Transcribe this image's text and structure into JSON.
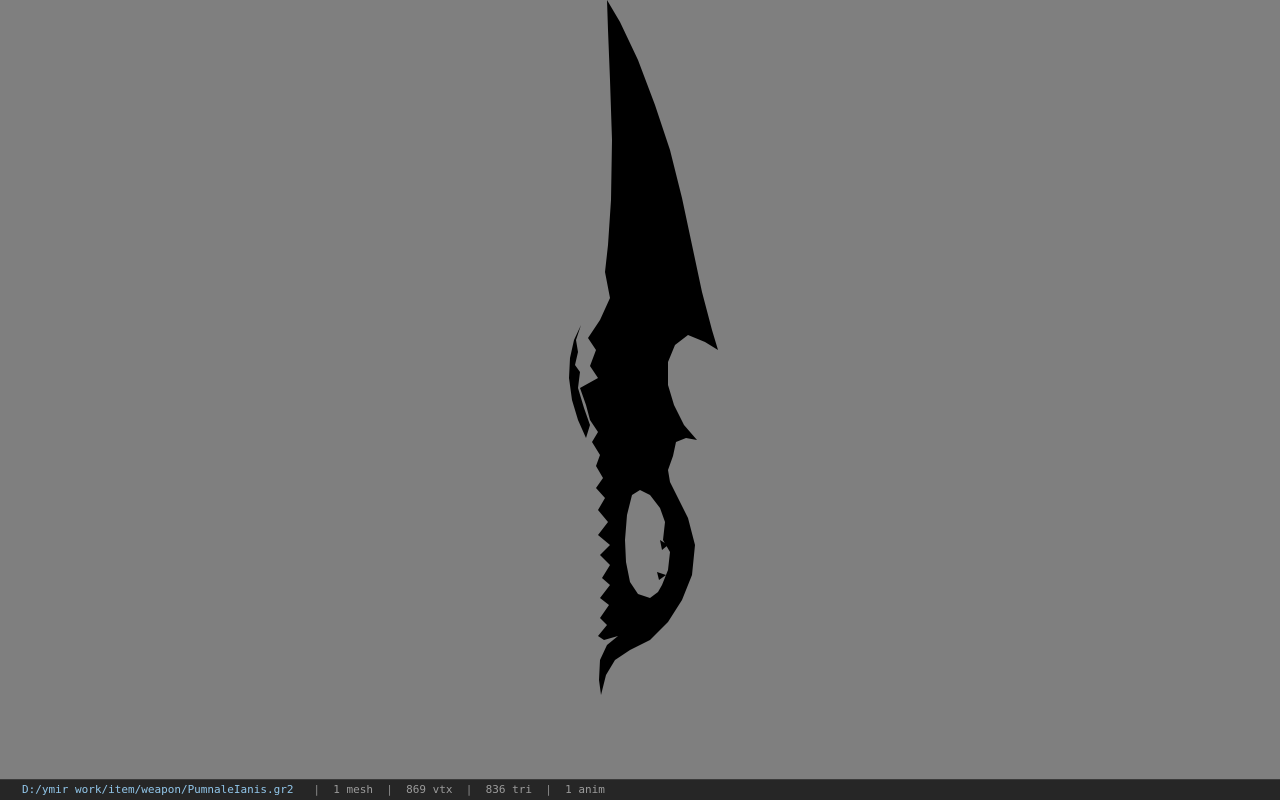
{
  "viewport": {
    "background": "#7f7f7f",
    "model_fill": "#000000"
  },
  "statusbar": {
    "file_path": "D:/ymir work/item/weapon/PumnaleIanis.gr2",
    "separator": "|",
    "mesh_count": "1 mesh",
    "vertex_count": "869 vtx",
    "triangle_count": "836 tri",
    "anim_count": "1 anim",
    "colors": {
      "background": "#262626",
      "path_text": "#8fc3e6",
      "stat_text": "#9a9a9a"
    }
  }
}
